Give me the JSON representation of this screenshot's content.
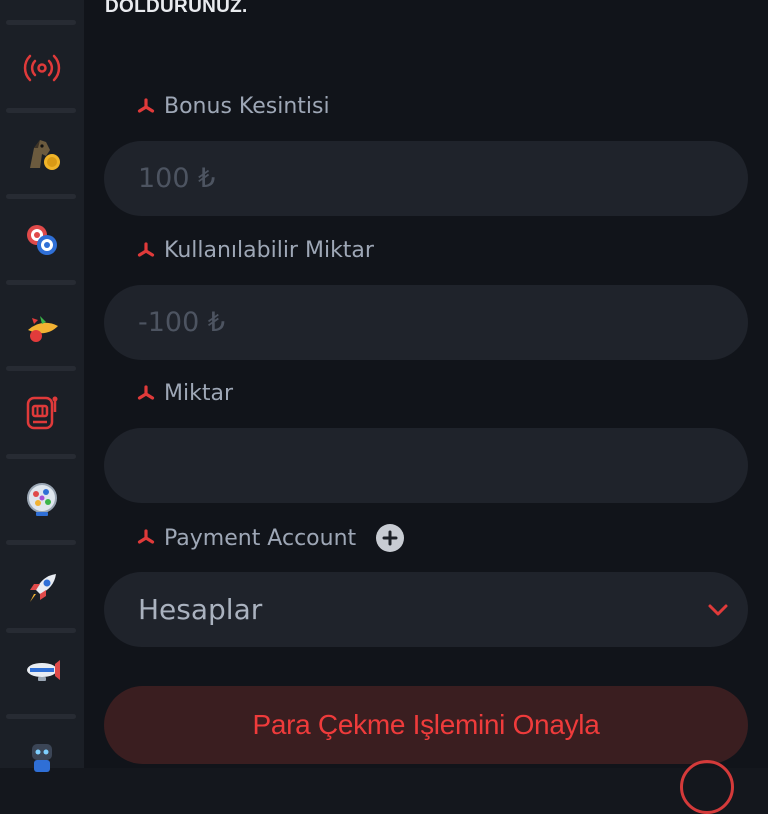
{
  "header": {
    "instruction_tail": "DOLDURUNUZ."
  },
  "sidebar": {
    "items": [
      {
        "icon": "live-broadcast-icon"
      },
      {
        "icon": "horse-racing-icon"
      },
      {
        "icon": "casino-chips-icon"
      },
      {
        "icon": "fruit-slots-icon"
      },
      {
        "icon": "slot-machine-icon"
      },
      {
        "icon": "lottery-ball-icon"
      },
      {
        "icon": "rocket-icon"
      },
      {
        "icon": "zeppelin-icon"
      },
      {
        "icon": "robot-icon"
      }
    ]
  },
  "form": {
    "bonus_deduction": {
      "label": "Bonus Kesintisi",
      "placeholder": "100 ₺"
    },
    "available_amount": {
      "label": "Kullanılabilir Miktar",
      "placeholder": "-100 ₺"
    },
    "amount": {
      "label": "Miktar",
      "placeholder": ""
    },
    "payment_account": {
      "label": "Payment Account",
      "selected": "Hesaplar"
    },
    "submit_label": "Para Çekme Işlemini Onayla"
  },
  "colors": {
    "accent_red": "#ef3b3b",
    "background": "#11141a",
    "field_bg": "#1f232b",
    "submit_bg": "#3a1e20"
  }
}
